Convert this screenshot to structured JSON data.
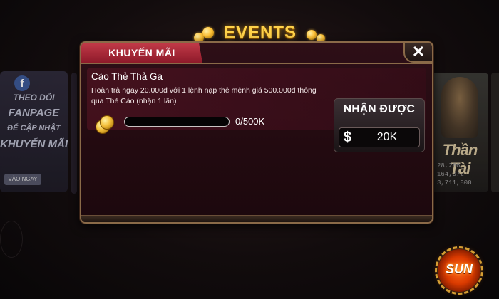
{
  "banner": {
    "title": "EVENTS"
  },
  "background": {
    "left_tile": {
      "lines": [
        "THEO DÕI",
        "FANPAGE",
        "ĐỂ CẬP NHẬT",
        "KHUYẾN MÃI"
      ],
      "button_label": "VÀO NGAY"
    },
    "right_tile": {
      "name": "Thần Tài",
      "numbers": [
        "28,286",
        "164,072",
        "3,711,800"
      ]
    }
  },
  "modal": {
    "tab_label": "KHUYẾN MÃI",
    "close_label": "✕"
  },
  "event": {
    "title": "Cào Thẻ Thả Ga",
    "description": "Hoàn trả ngay 20.000đ với 1 lệnh nạp thẻ mệnh giá 500.000đ thông qua Thẻ Cào (nhận 1 lần)",
    "progress_text": "0/500K",
    "progress_fraction": 0
  },
  "reward": {
    "title": "NHẬN ĐƯỢC",
    "currency_symbol": "$",
    "value": "20K"
  },
  "logo": {
    "text": "SUN"
  },
  "colors": {
    "accent_gold": "#ffd24a",
    "tab_red": "#c23a48",
    "modal_border": "#8a6a48",
    "progress_fill": "#d9a53a"
  }
}
